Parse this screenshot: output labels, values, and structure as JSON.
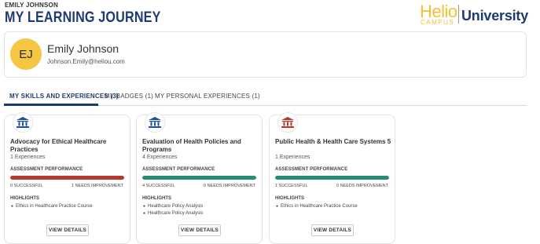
{
  "header": {
    "user_name": "EMILY JOHNSON",
    "page_title": "MY LEARNING JOURNEY",
    "logo": {
      "helio": "Helio",
      "campus": "CAMPUS",
      "university": "University"
    }
  },
  "profile": {
    "initials": "EJ",
    "name": "Emily Johnson",
    "email": "Johnson.Emily@heliou.com"
  },
  "tabs": [
    {
      "label": "MY SKILLS AND EXPERIENCES (3)",
      "active": true
    },
    {
      "label": "MY BADGES (1)",
      "active": false
    },
    {
      "label": "MY PERSONAL EXPERIENCES (1)",
      "active": false
    }
  ],
  "cards": [
    {
      "title": "Advocacy for Ethical Healthcare Practices",
      "experiences": "1 Experiences",
      "assessment_label": "ASSESSMENT PERFORMANCE",
      "successful": "0 SUCCESSFUL",
      "needs_improvement": "1 NEEDS IMPROVEMENT",
      "success_fraction": 0,
      "bar_color": "#b5382c",
      "icon_color": "#1e4f9c",
      "highlights_label": "HIGHLIGHTS",
      "highlights": [
        "Ethics in Healthcare Practice Course"
      ],
      "button": "VIEW DETAILS"
    },
    {
      "title": "Evaluation of Health Policies and Programs",
      "experiences": "4 Experiences",
      "assessment_label": "ASSESSMENT PERFORMANCE",
      "successful": "4 SUCCESSFUL",
      "needs_improvement": "0 NEEDS IMPROVEMENT",
      "success_fraction": 1,
      "bar_color": "#2a8a73",
      "icon_color": "#1e4f9c",
      "highlights_label": "HIGHLIGHTS",
      "highlights": [
        "Healthcare Policy Analysis",
        "Healthcare Policy Analysis"
      ],
      "button": "VIEW DETAILS"
    },
    {
      "title": "Public Health & Health Care Systems 5",
      "experiences": "1 Experiences",
      "assessment_label": "ASSESSMENT PERFORMANCE",
      "successful": "1 SUCCESSFUL",
      "needs_improvement": "0 NEEDS IMPROVEMENT",
      "success_fraction": 1,
      "bar_color": "#2a8a73",
      "icon_color": "#b5382c",
      "highlights_label": "HIGHLIGHTS",
      "highlights": [
        "Ethics in Healthcare Practice Course"
      ],
      "button": "VIEW DETAILS"
    }
  ]
}
